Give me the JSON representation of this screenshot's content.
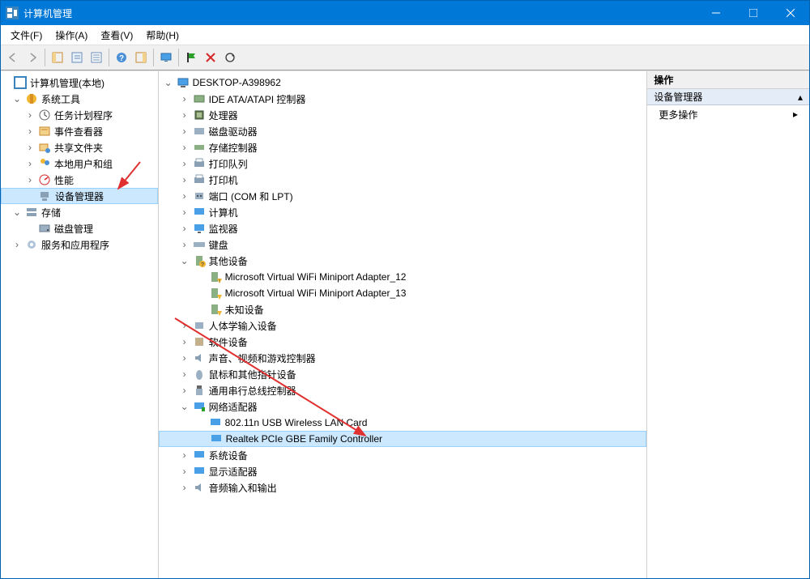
{
  "title": "计算机管理",
  "menu": {
    "file": "文件(F)",
    "action": "操作(A)",
    "view": "查看(V)",
    "help": "帮助(H)"
  },
  "leftTree": {
    "root": "计算机管理(本地)",
    "systemTools": "系统工具",
    "taskScheduler": "任务计划程序",
    "eventViewer": "事件查看器",
    "sharedFolders": "共享文件夹",
    "localUsers": "本地用户和组",
    "performance": "性能",
    "deviceManager": "设备管理器",
    "storage": "存储",
    "diskMgmt": "磁盘管理",
    "servicesApps": "服务和应用程序"
  },
  "midTree": {
    "root": "DESKTOP-A398962",
    "ide": "IDE ATA/ATAPI 控制器",
    "cpu": "处理器",
    "diskDrives": "磁盘驱动器",
    "storageCtrl": "存储控制器",
    "printQueues": "打印队列",
    "printers": "打印机",
    "ports": "端口 (COM 和 LPT)",
    "computer": "计算机",
    "monitors": "监视器",
    "keyboards": "键盘",
    "otherDevices": "其他设备",
    "wifi12": "Microsoft Virtual WiFi Miniport Adapter_12",
    "wifi13": "Microsoft Virtual WiFi Miniport Adapter_13",
    "unknown": "未知设备",
    "hid": "人体学输入设备",
    "software": "软件设备",
    "sound": "声音、视频和游戏控制器",
    "mice": "鼠标和其他指针设备",
    "usb": "通用串行总线控制器",
    "netAdapters": "网络适配器",
    "wlan": "802.11n USB Wireless LAN Card",
    "realtek": "Realtek PCIe GBE Family Controller",
    "sysDevices": "系统设备",
    "display": "显示适配器",
    "audioIO": "音频输入和输出"
  },
  "actions": {
    "header": "操作",
    "section": "设备管理器",
    "moreActions": "更多操作"
  }
}
